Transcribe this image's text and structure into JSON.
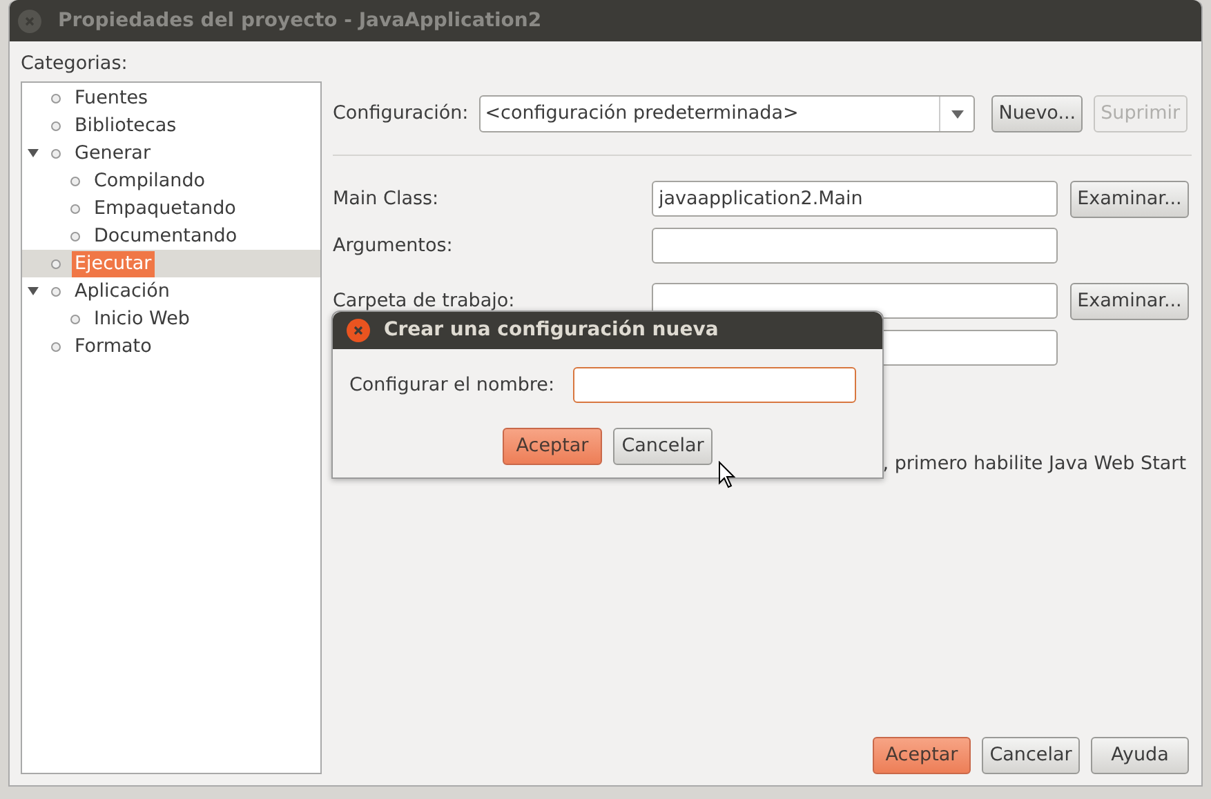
{
  "window": {
    "title": "Propiedades del proyecto - JavaApplication2"
  },
  "categories": {
    "label": "Categorias:",
    "items": [
      {
        "label": "Fuentes",
        "selected": false
      },
      {
        "label": "Bibliotecas",
        "selected": false
      },
      {
        "label": "Generar",
        "selected": false,
        "expanded": true,
        "children": [
          {
            "label": "Compilando",
            "selected": false
          },
          {
            "label": "Empaquetando",
            "selected": false
          },
          {
            "label": "Documentando",
            "selected": false
          }
        ]
      },
      {
        "label": "Ejecutar",
        "selected": true
      },
      {
        "label": "Aplicación",
        "selected": false,
        "expanded": true,
        "children": [
          {
            "label": "Inicio Web",
            "selected": false
          }
        ]
      },
      {
        "label": "Formato",
        "selected": false
      }
    ]
  },
  "configuration": {
    "label": "Configuración:",
    "value": "<configuración predeterminada>",
    "buttons": [
      {
        "label": "Nuevo...",
        "disabled": false
      },
      {
        "label": "Suprimir",
        "disabled": true
      }
    ]
  },
  "fields": [
    {
      "kind": "text",
      "label": "Main Class:",
      "value": "javaapplication2.Main",
      "button": {
        "label": "Examinar..."
      }
    },
    {
      "kind": "text",
      "label": "Argumentos:"
    },
    {
      "kind": "text",
      "label": "Carpeta de trabajo:",
      "button": {
        "label": "Examinar..."
      }
    },
    {
      "kind": "text"
    }
  ],
  "note": ", primero habilite Java Web Start",
  "dialog": {
    "title": "Crear una configuración nueva",
    "label": "Configurar el nombre:",
    "buttons": [
      {
        "label": "Aceptar",
        "kind": "default"
      },
      {
        "label": "Cancelar",
        "kind": "normal"
      }
    ]
  },
  "footer_buttons": [
    {
      "label": "Aceptar",
      "kind": "default"
    },
    {
      "label": "Cancelar",
      "kind": "normal"
    },
    {
      "label": "Ayuda",
      "kind": "normal"
    }
  ]
}
